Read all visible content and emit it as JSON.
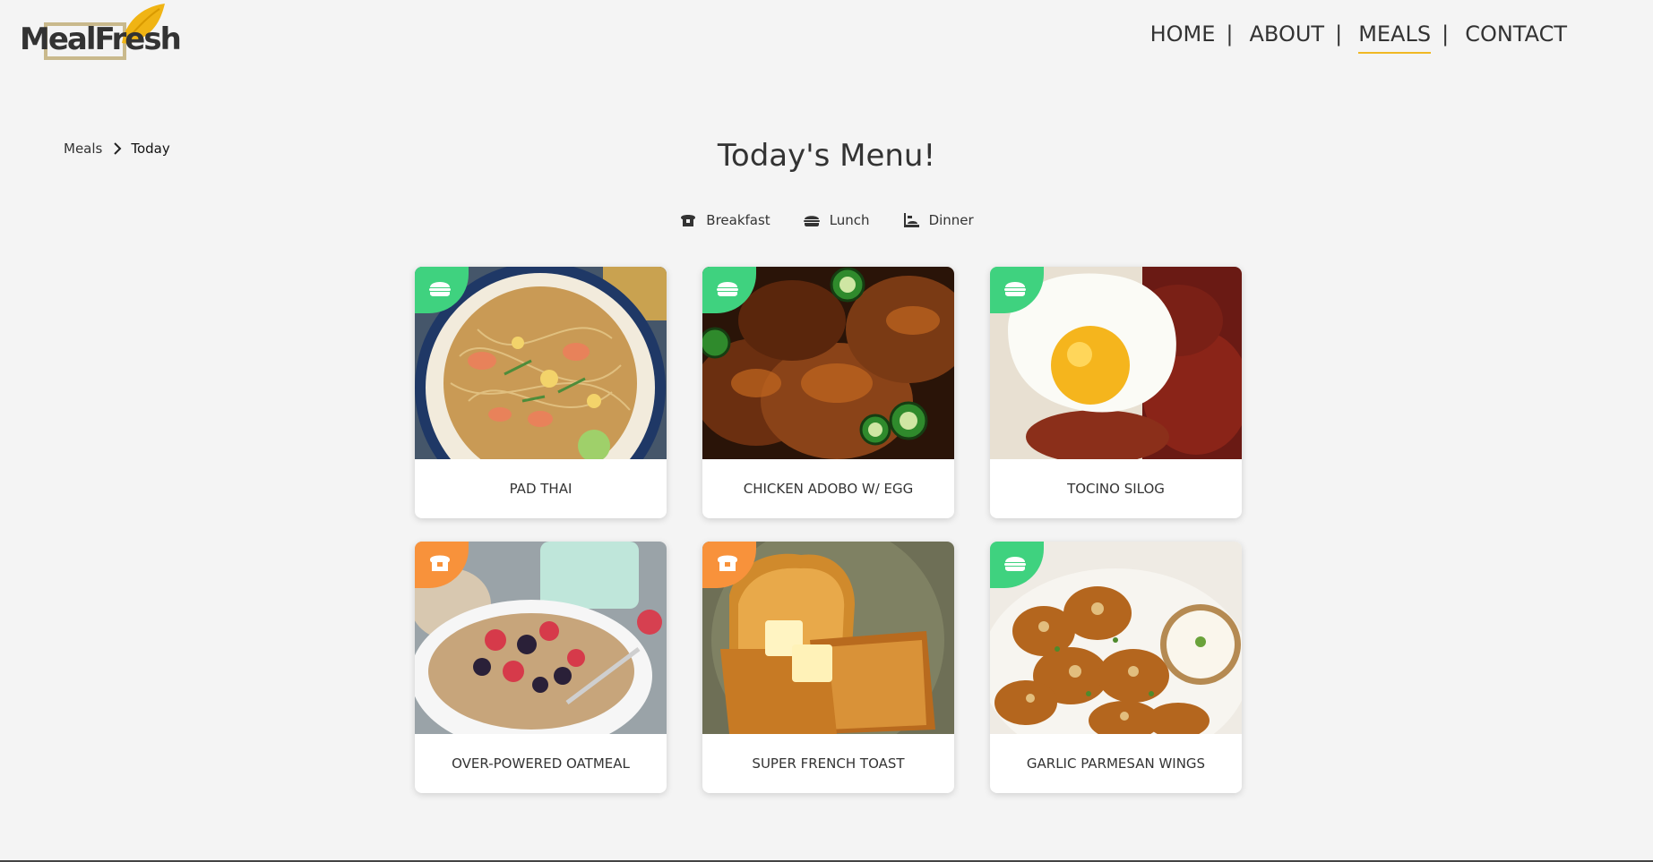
{
  "brand": {
    "name": "MealFresh"
  },
  "nav": {
    "items": [
      {
        "label": "HOME",
        "active": false
      },
      {
        "label": "ABOUT",
        "active": false
      },
      {
        "label": "MEALS",
        "active": true
      },
      {
        "label": "CONTACT",
        "active": false
      }
    ],
    "separator": "|"
  },
  "breadcrumb": {
    "parent": "Meals",
    "current": "Today"
  },
  "page": {
    "title": "Today's Menu!"
  },
  "filters": [
    {
      "label": "Breakfast",
      "icon": "bread-icon"
    },
    {
      "label": "Lunch",
      "icon": "burger-icon"
    },
    {
      "label": "Dinner",
      "icon": "dinner-icon"
    }
  ],
  "colors": {
    "lunch_badge": "#3fd27f",
    "breakfast_badge": "#f8923b",
    "accent": "#f0b823"
  },
  "meals": [
    {
      "name": "PAD THAI",
      "category": "lunch",
      "badge_icon": "burger-icon",
      "photo": "pad-thai-photo"
    },
    {
      "name": "CHICKEN ADOBO W/ EGG",
      "category": "lunch",
      "badge_icon": "burger-icon",
      "photo": "chicken-adobo-photo"
    },
    {
      "name": "TOCINO SILOG",
      "category": "lunch",
      "badge_icon": "burger-icon",
      "photo": "tocino-silog-photo"
    },
    {
      "name": "OVER-POWERED OATMEAL",
      "category": "breakfast",
      "badge_icon": "bread-icon",
      "photo": "oatmeal-photo"
    },
    {
      "name": "SUPER FRENCH TOAST",
      "category": "breakfast",
      "badge_icon": "bread-icon",
      "photo": "french-toast-photo"
    },
    {
      "name": "GARLIC PARMESAN WINGS",
      "category": "lunch",
      "badge_icon": "burger-icon",
      "photo": "garlic-wings-photo"
    }
  ]
}
